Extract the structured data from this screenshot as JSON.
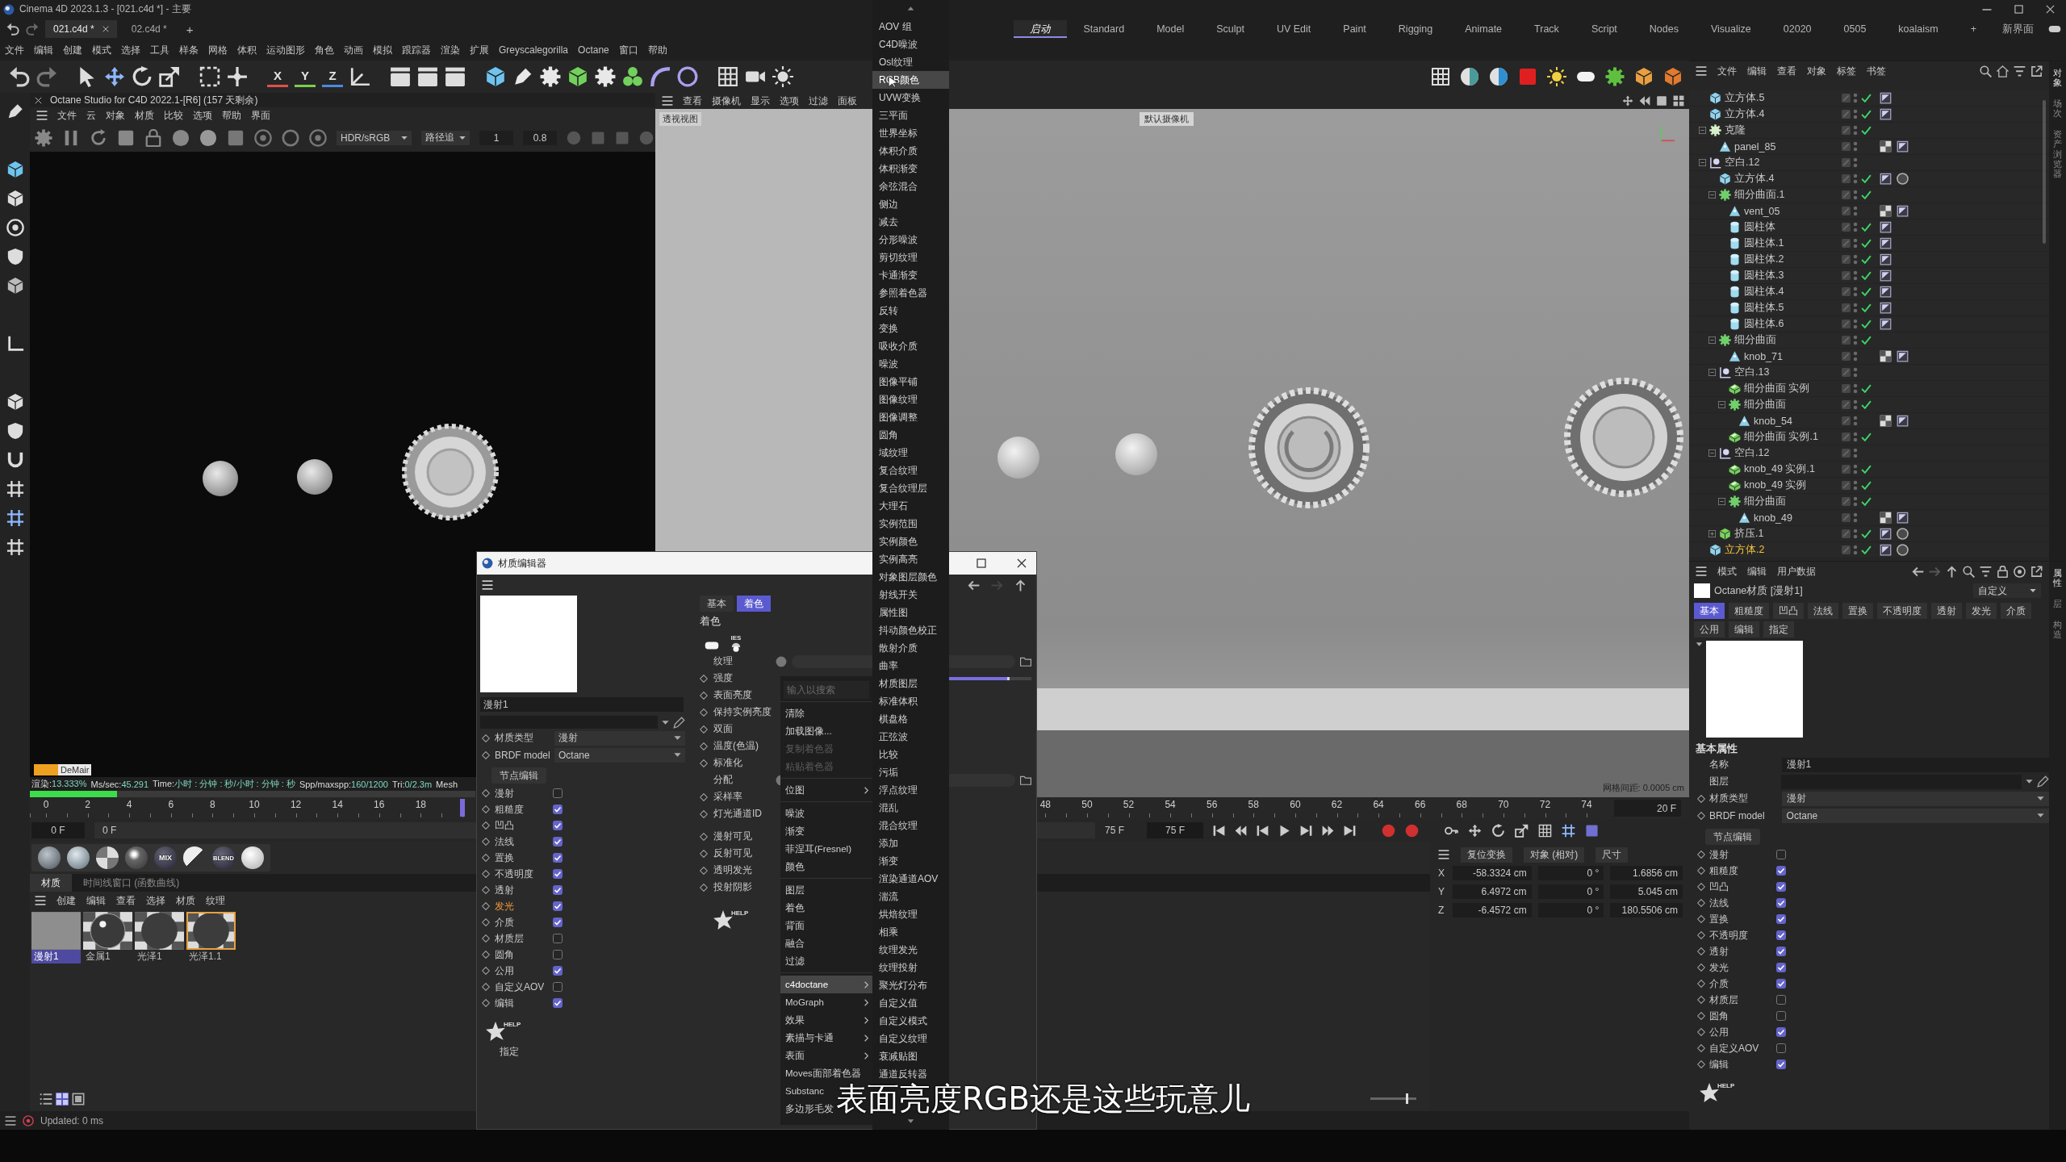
{
  "window": {
    "title": "Cinema 4D 2023.1.3 - [021.c4d *] - 主要"
  },
  "file_tabs": {
    "tabs": [
      {
        "label": "021.c4d *",
        "selected": true
      },
      {
        "label": "02.c4d *",
        "selected": false
      }
    ],
    "add": "+"
  },
  "layouts": {
    "tabs": [
      {
        "label": "启动",
        "selected": true
      },
      {
        "label": "Standard",
        "selected": false
      },
      {
        "label": "Model",
        "selected": false
      },
      {
        "label": "Sculpt",
        "selected": false
      },
      {
        "label": "UV Edit",
        "selected": false
      },
      {
        "label": "Paint",
        "selected": false
      },
      {
        "label": "Rigging",
        "selected": false
      },
      {
        "label": "Animate",
        "selected": false
      },
      {
        "label": "Track",
        "selected": false
      },
      {
        "label": "Script",
        "selected": false
      },
      {
        "label": "Nodes",
        "selected": false
      },
      {
        "label": "Visualize",
        "selected": false
      },
      {
        "label": "02020",
        "selected": false
      },
      {
        "label": "0505",
        "selected": false
      },
      {
        "label": "koalaism",
        "selected": false
      }
    ],
    "add": "+",
    "new_layout": "新界面"
  },
  "menu": [
    "文件",
    "编辑",
    "创建",
    "模式",
    "选择",
    "工具",
    "样条",
    "网格",
    "体积",
    "运动图形",
    "角色",
    "动画",
    "模拟",
    "跟踪器",
    "渲染",
    "扩展",
    "Greyscalegorilla",
    "Octane",
    "窗口",
    "帮助"
  ],
  "toolbar": {
    "axis_locks": [
      {
        "label": "X",
        "color": "#e0504a"
      },
      {
        "label": "Y",
        "color": "#7bd04a"
      },
      {
        "label": "Z",
        "color": "#4a8ae0"
      }
    ]
  },
  "octane": {
    "title": "Octane Studio for C4D 2022.1-[R6] (157 天剩余)",
    "menu": [
      "文件",
      "云",
      "对象",
      "材质",
      "比较",
      "选项",
      "帮助",
      "界面"
    ],
    "color_space": "HDR/sRGB",
    "kernel": "路径追",
    "value_1": "1",
    "value_2": "0.8",
    "badge": "DeMair",
    "stats": [
      {
        "label": "渲染:",
        "value": "13.333%"
      },
      {
        "label": "Ms/sec:",
        "value": "45.291"
      },
      {
        "label": "Time:",
        "value": "小时 : 分钟 : 秒/小时 : 分钟 : 秒"
      },
      {
        "label": "Spp/maxspp:",
        "value": "160/1200"
      },
      {
        "label": "Tri:",
        "value": "0/2.3m"
      },
      {
        "label": "Mesh"
      }
    ],
    "progress": {
      "level": 0.195
    }
  },
  "viewport": {
    "menu": [
      "查看",
      "摄像机",
      "显示",
      "选项",
      "过滤",
      "面板"
    ],
    "view_label": "透视视图",
    "camera_label": "默认摄像机",
    "grid_spacing": "网格间距: 0.0005 cm"
  },
  "timeline": {
    "tick_groups": [
      [
        "0",
        "2",
        "4",
        "6",
        "8",
        "10",
        "12",
        "14",
        "16",
        "18"
      ],
      [
        "48",
        "50",
        "52",
        "54",
        "56",
        "58",
        "60",
        "62",
        "64",
        "66",
        "68",
        "70",
        "72",
        "74"
      ]
    ],
    "playhead": {
      "level": 0.2667
    },
    "current": "20 F"
  },
  "playback": {
    "start": "0 F",
    "range_start": "0 F",
    "range_end": "75 F",
    "end": "75 F"
  },
  "material_presets": [
    {
      "kind": "matte"
    },
    {
      "kind": "glossy"
    },
    {
      "kind": "checker"
    },
    {
      "kind": "specular"
    },
    {
      "kind": "mix",
      "label": "MIX"
    },
    {
      "kind": "split"
    },
    {
      "kind": "blend",
      "label": "BLEND"
    },
    {
      "kind": "white"
    }
  ],
  "material_manager": {
    "tabs": [
      {
        "label": "材质",
        "selected": true
      },
      {
        "label": "时间线窗口 (函数曲线)",
        "selected": false
      }
    ],
    "menu": [
      "创建",
      "编辑",
      "查看",
      "选择",
      "材质",
      "纹理"
    ],
    "materials": [
      {
        "name": "漫射1",
        "kind": "flat",
        "selected": true,
        "outlined": false
      },
      {
        "name": "金属1",
        "kind": "chrome",
        "selected": false,
        "outlined": false
      },
      {
        "name": "光泽1",
        "kind": "dark",
        "selected": false,
        "outlined": false
      },
      {
        "name": "光泽1.1",
        "kind": "dark",
        "selected": false,
        "outlined": true
      }
    ],
    "view_modes": [
      {
        "kind": "list",
        "selected": false
      },
      {
        "kind": "grid",
        "selected": true
      },
      {
        "kind": "single",
        "selected": false
      }
    ]
  },
  "coordinates": {
    "headers": [
      "复位变换",
      "对象 (相对)",
      "尺寸"
    ],
    "rows": [
      {
        "axis": "X",
        "values": [
          "-58.3324 cm",
          "0 °",
          "1.6856 cm"
        ]
      },
      {
        "axis": "Y",
        "values": [
          "6.4972 cm",
          "0 °",
          "5.045 cm"
        ]
      },
      {
        "axis": "Z",
        "values": [
          "-6.4572 cm",
          "0 °",
          "180.5506 cm"
        ]
      }
    ]
  },
  "zoom_slider": {
    "level": 0.8
  },
  "status_bar": {
    "text": "Updated: 0 ms"
  },
  "object_manager": {
    "menu": [
      "文件",
      "编辑",
      "查看",
      "对象",
      "标签",
      "书签"
    ],
    "side_tabs": [
      {
        "label": "对象",
        "selected": true
      },
      {
        "label": "场次",
        "selected": false
      },
      {
        "label": "资产浏览器",
        "selected": false
      }
    ],
    "items": [
      {
        "name": "立方体.5",
        "kind": "cube",
        "enabled": true,
        "selected": false,
        "tags": [
          {
            "kind": "phong"
          }
        ]
      },
      {
        "name": "立方体.4",
        "kind": "cube",
        "enabled": true,
        "selected": false,
        "tags": [
          {
            "kind": "phong"
          }
        ]
      },
      {
        "name": "克隆",
        "kind": "cloner",
        "enabled": true,
        "selected": false,
        "expanded": true,
        "children": [
          {
            "name": "panel_85",
            "kind": "polygon",
            "enabled": false,
            "selected": false,
            "tags": [
              {
                "kind": "uvw"
              },
              {
                "kind": "phong"
              }
            ]
          }
        ]
      },
      {
        "name": "空白.12",
        "kind": "null",
        "enabled": false,
        "selected": false,
        "expanded": true,
        "children": [
          {
            "name": "立方体.4",
            "kind": "cube",
            "enabled": true,
            "selected": false,
            "tags": [
              {
                "kind": "phong"
              },
              {
                "kind": "material"
              }
            ]
          },
          {
            "name": "细分曲面.1",
            "kind": "subdivision",
            "enabled": true,
            "selected": false,
            "expanded": true,
            "children": [
              {
                "name": "vent_05",
                "kind": "polygon",
                "enabled": false,
                "selected": false,
                "tags": [
                  {
                    "kind": "uvw"
                  },
                  {
                    "kind": "phong"
                  }
                ]
              },
              {
                "name": "圆柱体",
                "kind": "cylinder",
                "enabled": true,
                "selected": false,
                "tags": [
                  {
                    "kind": "phong"
                  }
                ]
              },
              {
                "name": "圆柱体.1",
                "kind": "cylinder",
                "enabled": true,
                "selected": false,
                "tags": [
                  {
                    "kind": "phong"
                  }
                ]
              },
              {
                "name": "圆柱体.2",
                "kind": "cylinder",
                "enabled": true,
                "selected": false,
                "tags": [
                  {
                    "kind": "phong"
                  }
                ]
              },
              {
                "name": "圆柱体.3",
                "kind": "cylinder",
                "enabled": true,
                "selected": false,
                "tags": [
                  {
                    "kind": "phong"
                  }
                ]
              },
              {
                "name": "圆柱体.4",
                "kind": "cylinder",
                "enabled": true,
                "selected": false,
                "tags": [
                  {
                    "kind": "phong"
                  }
                ]
              },
              {
                "name": "圆柱体.5",
                "kind": "cylinder",
                "enabled": true,
                "selected": false,
                "tags": [
                  {
                    "kind": "phong"
                  }
                ]
              },
              {
                "name": "圆柱体.6",
                "kind": "cylinder",
                "enabled": true,
                "selected": false,
                "tags": [
                  {
                    "kind": "phong"
                  }
                ]
              }
            ]
          },
          {
            "name": "细分曲面",
            "kind": "subdivision",
            "enabled": true,
            "selected": false,
            "expanded": true,
            "children": [
              {
                "name": "knob_71",
                "kind": "polygon",
                "enabled": false,
                "selected": false,
                "tags": [
                  {
                    "kind": "uvw"
                  },
                  {
                    "kind": "phong"
                  }
                ]
              }
            ]
          },
          {
            "name": "空白.13",
            "kind": "null",
            "enabled": false,
            "selected": false,
            "expanded": true,
            "children": [
              {
                "name": "细分曲面 实例",
                "kind": "instance",
                "enabled": true,
                "selected": false
              },
              {
                "name": "细分曲面",
                "kind": "subdivision",
                "enabled": true,
                "selected": false,
                "expanded": true,
                "children": [
                  {
                    "name": "knob_54",
                    "kind": "polygon",
                    "enabled": false,
                    "selected": false,
                    "tags": [
                      {
                        "kind": "uvw"
                      },
                      {
                        "kind": "phong"
                      }
                    ]
                  }
                ]
              },
              {
                "name": "细分曲面 实例.1",
                "kind": "instance",
                "enabled": true,
                "selected": false
              }
            ]
          },
          {
            "name": "空白.12",
            "kind": "null",
            "enabled": false,
            "selected": false,
            "expanded": true,
            "children": [
              {
                "name": "knob_49 实例.1",
                "kind": "instance",
                "enabled": true,
                "selected": false
              },
              {
                "name": "knob_49 实例",
                "kind": "instance",
                "enabled": true,
                "selected": false
              },
              {
                "name": "细分曲面",
                "kind": "subdivision",
                "enabled": true,
                "selected": false,
                "expanded": true,
                "children": [
                  {
                    "name": "knob_49",
                    "kind": "polygon",
                    "enabled": false,
                    "selected": false,
                    "tags": [
                      {
                        "kind": "uvw"
                      },
                      {
                        "kind": "phong"
                      }
                    ]
                  }
                ]
              }
            ]
          },
          {
            "name": "挤压.1",
            "kind": "extrude",
            "enabled": true,
            "selected": false,
            "expanded": false,
            "tags": [
              {
                "kind": "phong"
              },
              {
                "kind": "material"
              }
            ]
          }
        ]
      },
      {
        "name": "立方体.2",
        "kind": "cube",
        "enabled": true,
        "selected": true,
        "tags": [
          {
            "kind": "phong"
          },
          {
            "kind": "material"
          }
        ]
      }
    ]
  },
  "attribute_manager": {
    "menu": [
      "模式",
      "编辑",
      "用户数据"
    ],
    "title": "Octane材质 [漫射1]",
    "preset": "自定义",
    "side_tabs": [
      {
        "label": "属性",
        "selected": true
      },
      {
        "label": "层",
        "selected": false
      },
      {
        "label": "构造",
        "selected": false
      }
    ],
    "tabs": [
      {
        "label": "基本",
        "selected": true
      },
      {
        "label": "粗糙度",
        "selected": false
      },
      {
        "label": "凹凸",
        "selected": false
      },
      {
        "label": "法线",
        "selected": false
      },
      {
        "label": "置换",
        "selected": false
      },
      {
        "label": "不透明度",
        "selected": false
      },
      {
        "label": "透射",
        "selected": false
      },
      {
        "label": "发光",
        "selected": false
      },
      {
        "label": "介质",
        "selected": false
      },
      {
        "label": "公用",
        "selected": false
      },
      {
        "label": "编辑",
        "selected": false
      },
      {
        "label": "指定",
        "selected": false
      }
    ],
    "section": "基本属性",
    "name_label": "名称",
    "name": "漫射1",
    "layer_label": "图层",
    "type_label": "材质类型",
    "type": "漫射",
    "brdf_label": "BRDF model",
    "brdf": "Octane",
    "node_editor": "节点编辑",
    "channels": [
      {
        "label": "漫射",
        "checked": false
      },
      {
        "label": "粗糙度",
        "checked": true
      },
      {
        "label": "凹凸",
        "checked": true
      },
      {
        "label": "法线",
        "checked": true
      },
      {
        "label": "置换",
        "checked": true
      },
      {
        "label": "不透明度",
        "checked": true
      },
      {
        "label": "透射",
        "checked": true
      },
      {
        "label": "发光",
        "checked": true
      },
      {
        "label": "介质",
        "checked": true
      },
      {
        "label": "材质层",
        "checked": false
      },
      {
        "label": "圆角",
        "checked": false
      },
      {
        "label": "公用",
        "checked": true
      },
      {
        "label": "自定义AOV",
        "checked": false
      },
      {
        "label": "编辑",
        "checked": true
      }
    ],
    "help": "HELP"
  },
  "material_editor": {
    "title": "材质编辑器",
    "name": "漫射1",
    "type_label": "材质类型",
    "type": "漫射",
    "brdf_label": "BRDF model",
    "brdf": "Octane",
    "node_editor": "节点编辑",
    "channels": [
      {
        "label": "漫射",
        "checked": false,
        "selected": false
      },
      {
        "label": "粗糙度",
        "checked": true,
        "selected": false
      },
      {
        "label": "凹凸",
        "checked": true,
        "selected": false
      },
      {
        "label": "法线",
        "checked": true,
        "selected": false
      },
      {
        "label": "置换",
        "checked": true,
        "selected": false
      },
      {
        "label": "不透明度",
        "checked": true,
        "selected": false
      },
      {
        "label": "透射",
        "checked": true,
        "selected": false
      },
      {
        "label": "发光",
        "checked": true,
        "selected": true
      },
      {
        "label": "介质",
        "checked": true,
        "selected": false
      },
      {
        "label": "材质层",
        "checked": false,
        "selected": false
      },
      {
        "label": "圆角",
        "checked": false,
        "selected": false
      },
      {
        "label": "公用",
        "checked": true,
        "selected": false
      },
      {
        "label": "自定义AOV",
        "checked": false,
        "selected": false
      },
      {
        "label": "编辑",
        "checked": true,
        "selected": false
      }
    ],
    "help_left": "HELP",
    "assign": "指定",
    "tabs": [
      {
        "label": "基本",
        "selected": false
      },
      {
        "label": "着色",
        "selected": true
      }
    ],
    "heading": "着色",
    "ies": "IES",
    "param_groups": [
      [
        {
          "label": "纹理",
          "keyframe": false,
          "kind": "texture"
        },
        {
          "label": "强度",
          "keyframe": true,
          "kind": "slider",
          "level": 0.9
        },
        {
          "label": "表面亮度",
          "keyframe": true,
          "kind": "plain"
        },
        {
          "label": "保持实例亮度",
          "keyframe": true,
          "kind": "plain"
        },
        {
          "label": "双面",
          "keyframe": true,
          "kind": "plain"
        },
        {
          "label": "温度(色温)",
          "keyframe": true,
          "kind": "plain"
        },
        {
          "label": "标准化",
          "keyframe": true,
          "kind": "plain"
        },
        {
          "label": "分配",
          "keyframe": false,
          "kind": "texture"
        },
        {
          "label": "采样率",
          "keyframe": true,
          "kind": "plain"
        },
        {
          "label": "灯光通道ID",
          "keyframe": true,
          "kind": "plain"
        }
      ],
      [
        {
          "label": "漫射可见",
          "keyframe": true,
          "kind": "plain"
        },
        {
          "label": "反射可见",
          "keyframe": true,
          "kind": "plain"
        },
        {
          "label": "透明发光",
          "keyframe": true,
          "kind": "plain"
        },
        {
          "label": "投射阴影",
          "keyframe": true,
          "kind": "plain"
        }
      ]
    ],
    "help_right": "HELP"
  },
  "context_menu": {
    "search_placeholder": "输入以搜索",
    "groups": [
      [
        {
          "label": "清除",
          "kind": "command",
          "disabled": false,
          "selected": false
        },
        {
          "label": "加载图像...",
          "kind": "command",
          "disabled": false,
          "selected": false
        },
        {
          "label": "复制着色器",
          "kind": "command",
          "disabled": true,
          "selected": false
        },
        {
          "label": "粘贴着色器",
          "kind": "command",
          "disabled": true,
          "selected": false
        }
      ],
      [
        {
          "label": "位图",
          "kind": "submenu",
          "disabled": false,
          "selected": false
        }
      ],
      [
        {
          "label": "噪波",
          "kind": "command",
          "disabled": false,
          "selected": false
        },
        {
          "label": "渐变",
          "kind": "command",
          "disabled": false,
          "selected": false
        },
        {
          "label": "菲涅耳(Fresnel)",
          "kind": "command",
          "disabled": false,
          "selected": false
        },
        {
          "label": "颜色",
          "kind": "command",
          "disabled": false,
          "selected": false
        }
      ],
      [
        {
          "label": "图层",
          "kind": "command",
          "disabled": false,
          "selected": false
        },
        {
          "label": "着色",
          "kind": "command",
          "disabled": false,
          "selected": false
        },
        {
          "label": "背面",
          "kind": "command",
          "disabled": false,
          "selected": false
        },
        {
          "label": "融合",
          "kind": "command",
          "disabled": false,
          "selected": false
        },
        {
          "label": "过滤",
          "kind": "command",
          "disabled": false,
          "selected": false
        }
      ],
      [
        {
          "label": "c4doctane",
          "kind": "submenu",
          "disabled": false,
          "selected": true
        },
        {
          "label": "MoGraph",
          "kind": "submenu",
          "disabled": false,
          "selected": false
        },
        {
          "label": "效果",
          "kind": "submenu",
          "disabled": false,
          "selected": false
        },
        {
          "label": "素描与卡通",
          "kind": "submenu",
          "disabled": false,
          "selected": false
        },
        {
          "label": "表面",
          "kind": "submenu",
          "disabled": false,
          "selected": false
        },
        {
          "label": "Moves面部着色器",
          "kind": "command",
          "disabled": false,
          "selected": false
        },
        {
          "label": "Substanc",
          "kind": "command",
          "disabled": false,
          "selected": false
        },
        {
          "label": "多边形毛发",
          "kind": "command",
          "disabled": false,
          "selected": false
        }
      ]
    ]
  },
  "shader_submenu": {
    "items": [
      {
        "label": "AOV 组",
        "selected": false
      },
      {
        "label": "C4D噪波",
        "selected": false
      },
      {
        "label": "Osl纹理",
        "selected": false
      },
      {
        "label": "RGB颜色",
        "selected": true
      },
      {
        "label": "UVW变换",
        "selected": false
      },
      {
        "label": "三平面",
        "selected": false
      },
      {
        "label": "世界坐标",
        "selected": false
      },
      {
        "label": "体积介质",
        "selected": false
      },
      {
        "label": "体积渐变",
        "selected": false
      },
      {
        "label": "余弦混合",
        "selected": false
      },
      {
        "label": "侧边",
        "selected": false
      },
      {
        "label": "减去",
        "selected": false
      },
      {
        "label": "分形噪波",
        "selected": false
      },
      {
        "label": "剪切纹理",
        "selected": false
      },
      {
        "label": "卡通渐变",
        "selected": false
      },
      {
        "label": "参照着色器",
        "selected": false
      },
      {
        "label": "反转",
        "selected": false
      },
      {
        "label": "变换",
        "selected": false
      },
      {
        "label": "吸收介质",
        "selected": false
      },
      {
        "label": "噪波",
        "selected": false
      },
      {
        "label": "图像平铺",
        "selected": false
      },
      {
        "label": "图像纹理",
        "selected": false
      },
      {
        "label": "图像调整",
        "selected": false
      },
      {
        "label": "圆角",
        "selected": false
      },
      {
        "label": "域纹理",
        "selected": false
      },
      {
        "label": "复合纹理",
        "selected": false
      },
      {
        "label": "复合纹理层",
        "selected": false
      },
      {
        "label": "大理石",
        "selected": false
      },
      {
        "label": "实例范围",
        "selected": false
      },
      {
        "label": "实例颜色",
        "selected": false
      },
      {
        "label": "实例高亮",
        "selected": false
      },
      {
        "label": "对象图层颜色",
        "selected": false
      },
      {
        "label": "射线开关",
        "selected": false
      },
      {
        "label": "属性图",
        "selected": false
      },
      {
        "label": "抖动颜色校正",
        "selected": false
      },
      {
        "label": "散射介质",
        "selected": false
      },
      {
        "label": "曲率",
        "selected": false
      },
      {
        "label": "材质图层",
        "selected": false
      },
      {
        "label": "标准体积",
        "selected": false
      },
      {
        "label": "棋盘格",
        "selected": false
      },
      {
        "label": "正弦波",
        "selected": false
      },
      {
        "label": "比较",
        "selected": false
      },
      {
        "label": "污垢",
        "selected": false
      },
      {
        "label": "浮点纹理",
        "selected": false
      },
      {
        "label": "混乱",
        "selected": false
      },
      {
        "label": "混合纹理",
        "selected": false
      },
      {
        "label": "添加",
        "selected": false
      },
      {
        "label": "渐变",
        "selected": false
      },
      {
        "label": "渲染通道AOV",
        "selected": false
      },
      {
        "label": "湍流",
        "selected": false
      },
      {
        "label": "烘焙纹理",
        "selected": false
      },
      {
        "label": "相乘",
        "selected": false
      },
      {
        "label": "纹理发光",
        "selected": false
      },
      {
        "label": "纹理投射",
        "selected": false
      },
      {
        "label": "聚光灯分布",
        "selected": false
      },
      {
        "label": "自定义值",
        "selected": false
      },
      {
        "label": "自定义模式",
        "selected": false
      },
      {
        "label": "自定义纹理",
        "selected": false
      },
      {
        "label": "衰减贴图",
        "selected": false
      },
      {
        "label": "通道反转器",
        "selected": false
      }
    ]
  },
  "subtitle": "表面亮度RGB还是这些玩意儿"
}
